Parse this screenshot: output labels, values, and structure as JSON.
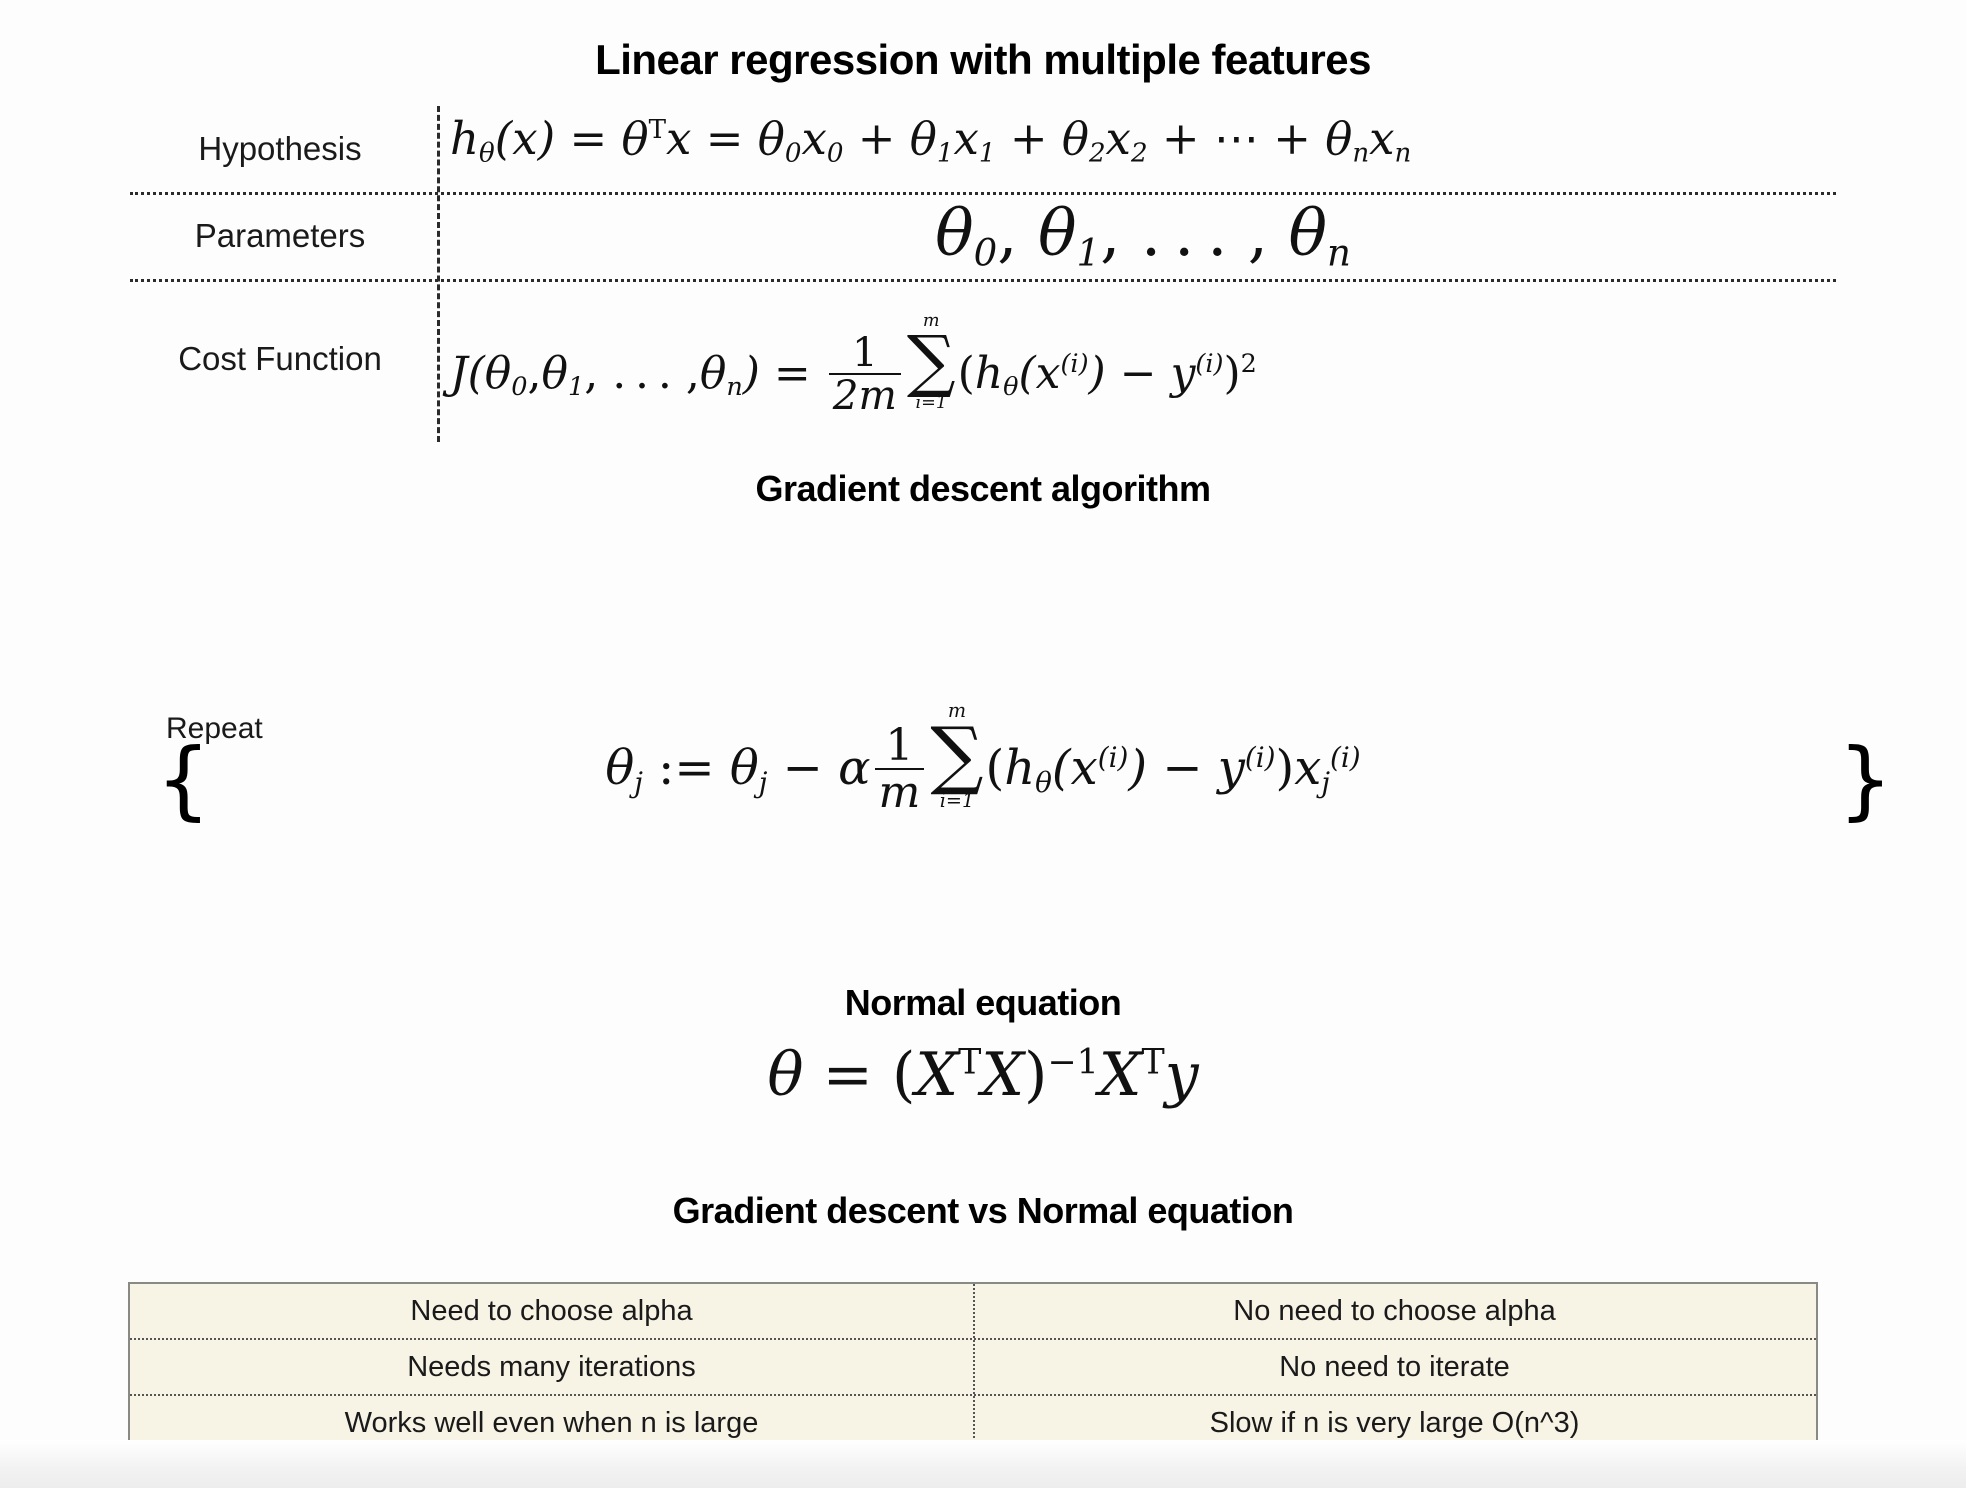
{
  "slide": {
    "title": "Linear regression with multiple features"
  },
  "definitions": {
    "rows": [
      {
        "label": "Hypothesis",
        "formula": "h_θ(x) = θ^T x = θ_0 x_0 + θ_1 x_1 + θ_2 x_2 + ⋯ + θ_n x_n"
      },
      {
        "label": "Parameters",
        "formula": "θ_0, θ_1, …, θ_n"
      },
      {
        "label": "Cost Function",
        "formula": "J(θ_0, θ_1, …, θ_n) = (1/2m) Σ_{i=1}^{m} (h_θ(x^(i)) − y^(i))^2"
      }
    ]
  },
  "gradient_descent": {
    "title": "Gradient descent algorithm",
    "repeat_label": "Repeat",
    "brace_open": "{",
    "brace_close": "}",
    "formula": "θ_j := θ_j − α (1/m) Σ_{i=1}^{m} (h_θ(x^(i)) − y^(i)) x_j^(i)"
  },
  "normal_equation": {
    "title": "Normal equation",
    "formula": "θ = (X^T X)^{−1} X^T y"
  },
  "comparison": {
    "title": "Gradient descent vs Normal equation",
    "rows": [
      {
        "gradient_descent": "Need to choose alpha",
        "normal_equation": "No need to choose alpha"
      },
      {
        "gradient_descent": "Needs many iterations",
        "normal_equation": "No need to iterate"
      },
      {
        "gradient_descent": "Works well even when n is large",
        "normal_equation": "Slow if n is very large O(n^3)"
      }
    ]
  },
  "symbols": {
    "theta": "θ",
    "alpha": "α",
    "sigma": "∑",
    "x": "x",
    "y": "y",
    "h": "h",
    "J": "J",
    "m": "m",
    "n": "n",
    "i": "i",
    "j": "j",
    "T": "T",
    "X": "X",
    "one": "1",
    "two": "2",
    "zero": "0",
    "ellipsis": "⋯",
    "dots": "…",
    "assign": ":=",
    "equals": "=",
    "minus": "−",
    "plus": "+",
    "lparen": "(",
    "rparen": ")",
    "comma": ",",
    "ieq1": "i=1"
  },
  "colors": {
    "background": "#fdfdfd",
    "text": "#111111",
    "table_fill": "#f7f3e5",
    "table_border": "#8a8a84",
    "rule": "#2b2b2b"
  }
}
